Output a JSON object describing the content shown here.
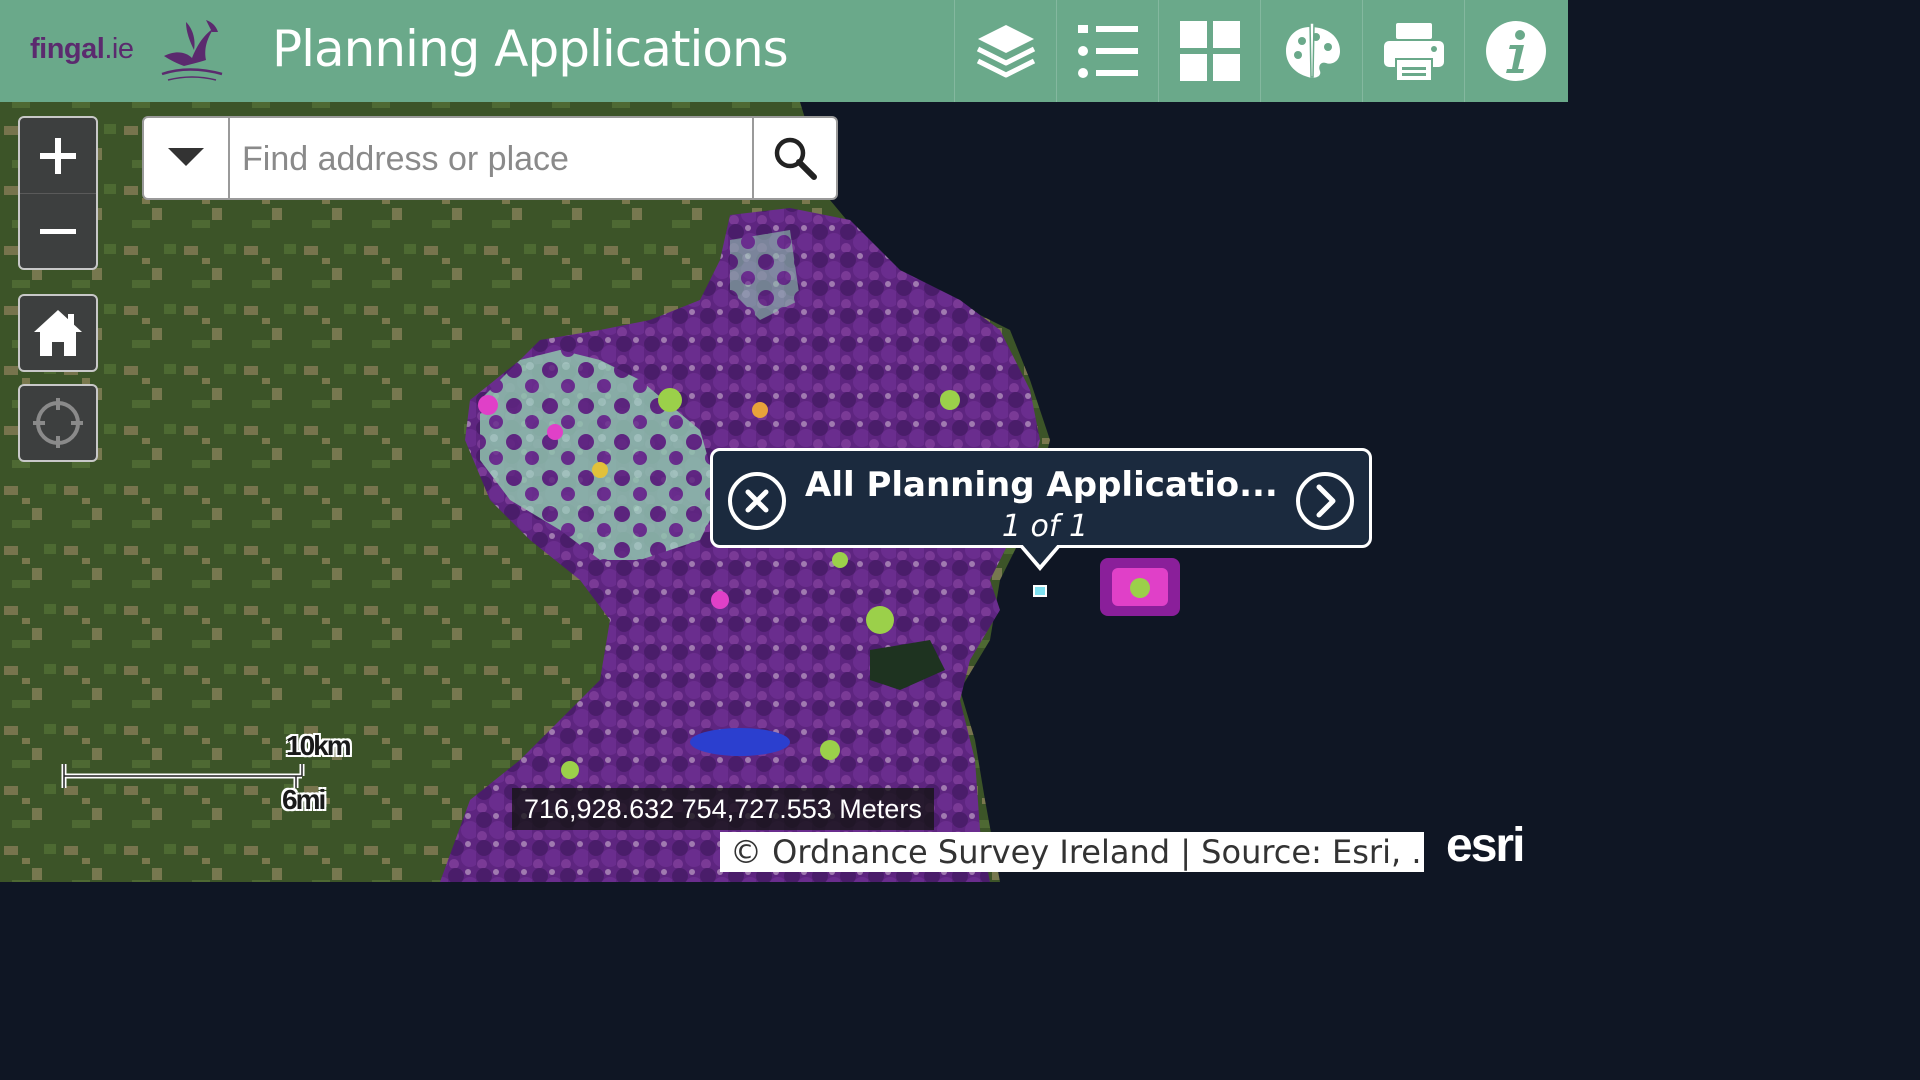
{
  "header": {
    "logo_brand": "fingal",
    "logo_domain": ".ie",
    "title": "Planning Applications",
    "tools": [
      {
        "name": "layers-icon",
        "label": "Layers"
      },
      {
        "name": "legend-icon",
        "label": "Legend"
      },
      {
        "name": "basemap-gallery-icon",
        "label": "Basemap Gallery"
      },
      {
        "name": "palette-icon",
        "label": "Style"
      },
      {
        "name": "print-icon",
        "label": "Print"
      },
      {
        "name": "info-icon",
        "label": "About"
      }
    ],
    "colors": {
      "bar": "#6aa98a",
      "brand": "#5b2a6e"
    }
  },
  "map_controls": {
    "zoom_in": "+",
    "zoom_out": "−",
    "home": "home-icon",
    "locate": "locate-icon"
  },
  "search": {
    "placeholder": "Find address or place",
    "value": ""
  },
  "popup": {
    "title": "All Planning Applicatio...",
    "count": "1 of 1"
  },
  "scale": {
    "metric": "10km",
    "imperial": "6mi"
  },
  "coordinates": "716,928.632 754,727.553 Meters",
  "attribution": "© Ordnance Survey Ireland | Source: Esri, ...",
  "esri_logo": "esri"
}
